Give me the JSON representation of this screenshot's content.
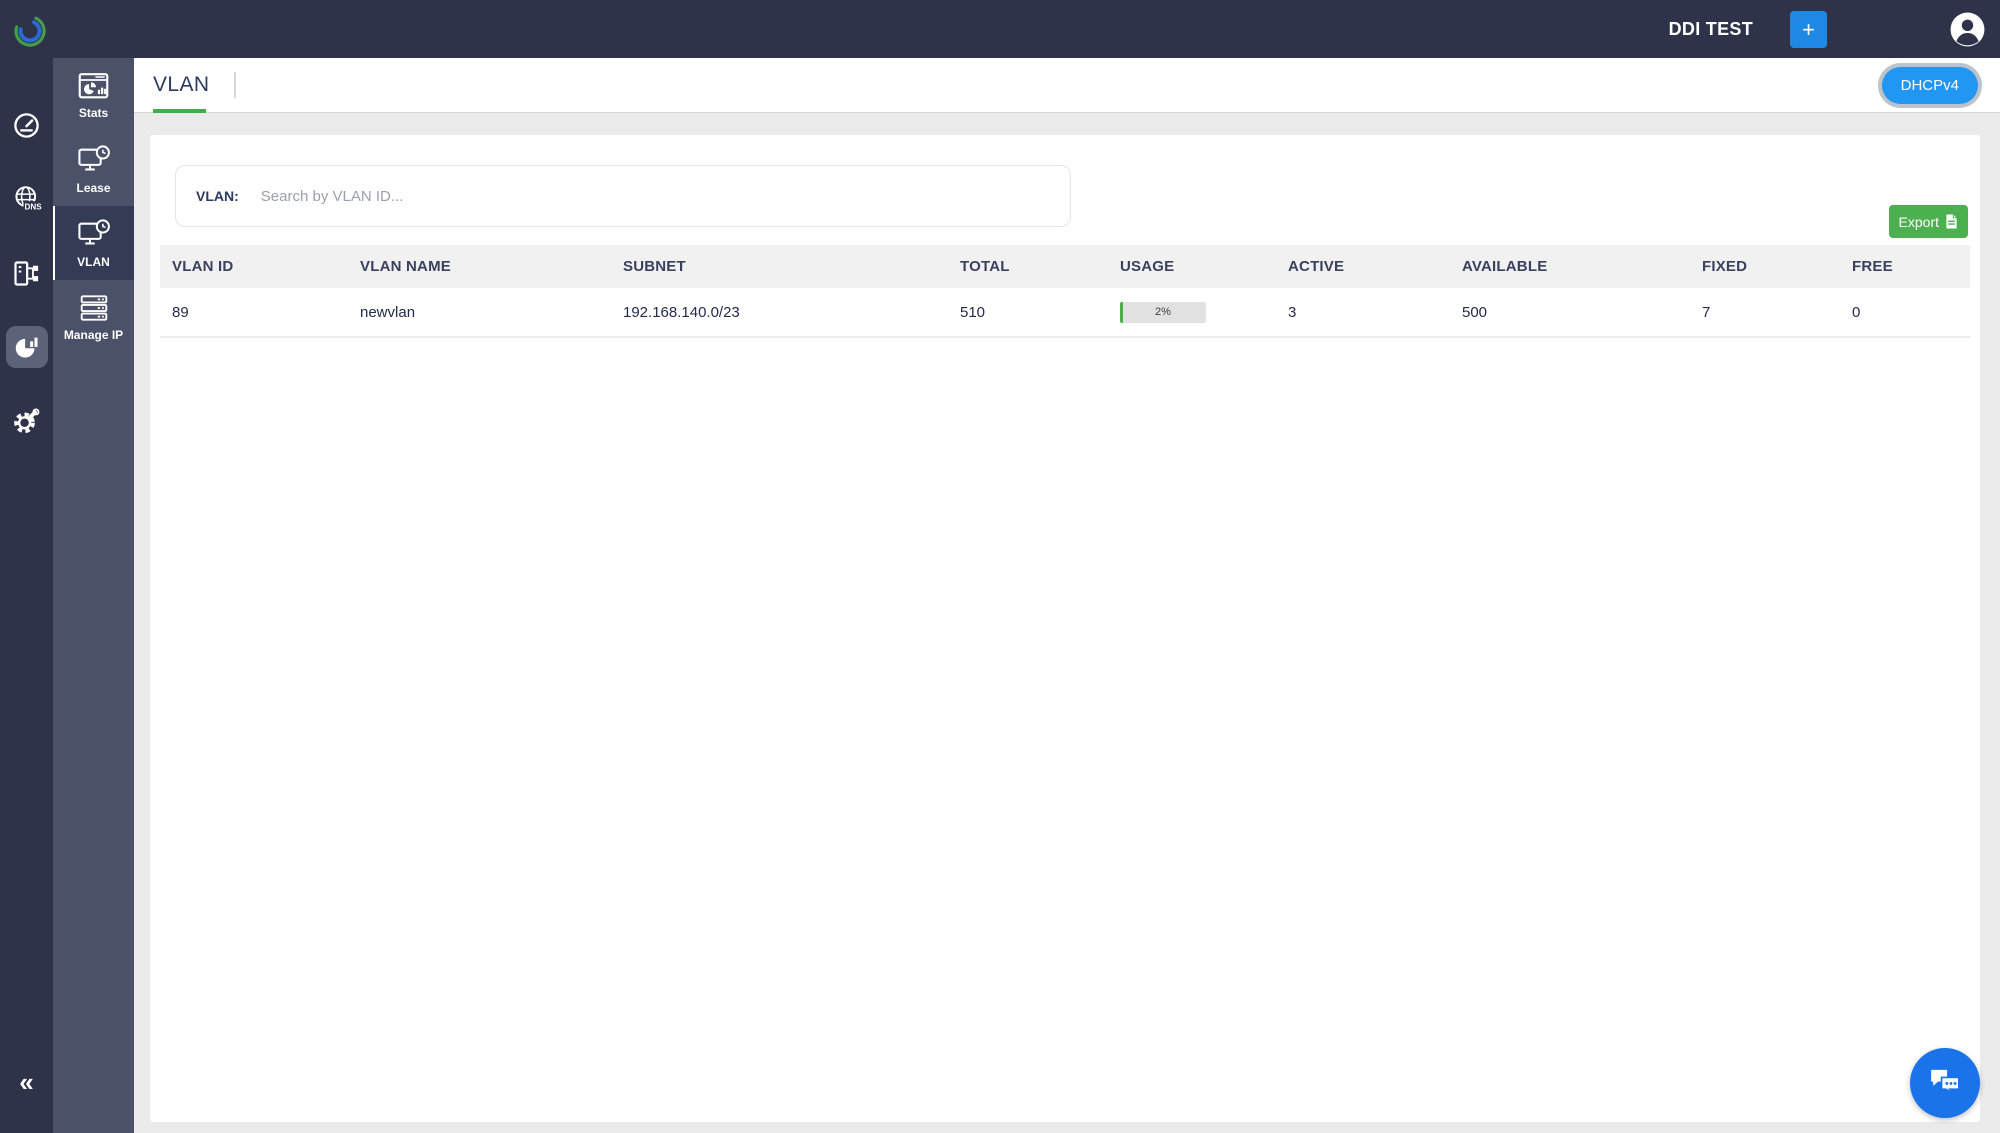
{
  "topbar": {
    "title": "DDI TEST",
    "add_button_label": "+"
  },
  "primary_nav": {
    "dns_badge": "DNS",
    "collapse_label": "«",
    "items": [
      {
        "name": "dashboard",
        "active": false
      },
      {
        "name": "dns",
        "active": false
      },
      {
        "name": "ipam",
        "active": false
      },
      {
        "name": "dhcp",
        "active": true
      },
      {
        "name": "settings",
        "active": false
      }
    ]
  },
  "secondary_nav": {
    "items": [
      {
        "label": "Stats",
        "active": false
      },
      {
        "label": "Lease",
        "active": false
      },
      {
        "label": "VLAN",
        "active": true
      },
      {
        "label": "Manage IP",
        "active": false
      }
    ]
  },
  "page": {
    "tab_label": "VLAN",
    "mode_button_label": "DHCPv4",
    "search": {
      "label": "VLAN:",
      "value": "",
      "placeholder": "Search by VLAN ID..."
    },
    "export_button_label": "Export",
    "table": {
      "columns": [
        "VLAN ID",
        "VLAN NAME",
        "SUBNET",
        "TOTAL",
        "USAGE",
        "ACTIVE",
        "AVAILABLE",
        "FIXED",
        "FREE"
      ],
      "rows": [
        {
          "vlan_id": "89",
          "vlan_name": "newvlan",
          "subnet": "192.168.140.0/23",
          "total": "510",
          "usage_label": "2%",
          "usage_percent": 2,
          "active": "3",
          "available": "500",
          "fixed": "7",
          "free": "0"
        }
      ]
    }
  },
  "colors": {
    "chrome_dark": "#2e3349",
    "chrome_mid": "#4b5168",
    "accent_blue": "#2196f3",
    "button_blue": "#1e88e5",
    "chat_blue": "#1a73e8",
    "accent_green": "#4caf50",
    "tab_underline_green": "#3faf4a"
  }
}
